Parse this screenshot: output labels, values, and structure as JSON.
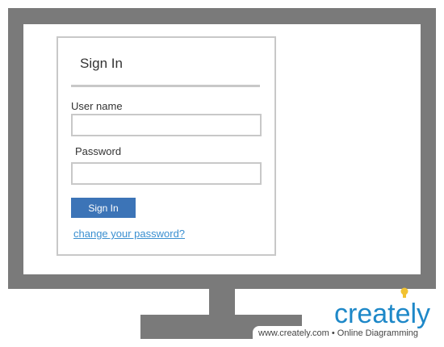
{
  "login": {
    "title": "Sign In",
    "username_label": "User name",
    "username_value": "",
    "password_label": "Password",
    "password_value": "",
    "signin_button": "Sign In",
    "change_password_link": "change your password?"
  },
  "branding": {
    "logo": "creately",
    "footer": "www.creately.com • Online Diagramming"
  },
  "colors": {
    "frame": "#7a7a7a",
    "button": "#3c74b7",
    "link": "#3a8fd0",
    "logo": "#1e88c8",
    "bulb": "#f1c232"
  }
}
